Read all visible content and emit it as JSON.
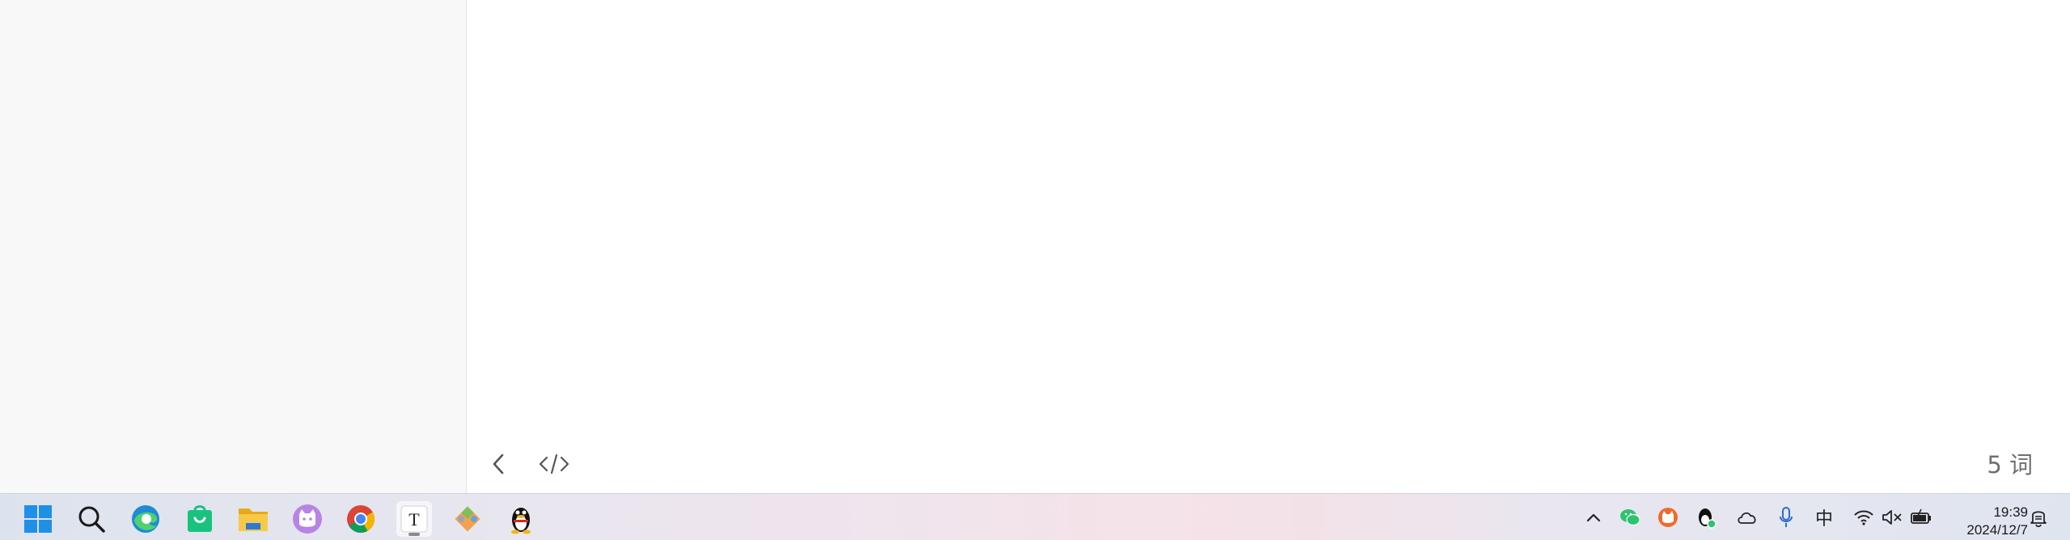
{
  "editor": {
    "word_count": "5 词",
    "footer": {
      "back_icon": "chevron-left-icon",
      "source_icon": "code-icon"
    }
  },
  "taskbar": {
    "apps": [
      {
        "name": "start-button",
        "icon": "windows-logo-icon"
      },
      {
        "name": "search-button",
        "icon": "search-icon"
      },
      {
        "name": "edge-app",
        "icon": "edge-icon"
      },
      {
        "name": "store-app",
        "icon": "shopping-bag-icon"
      },
      {
        "name": "explorer-app",
        "icon": "folder-icon"
      },
      {
        "name": "cat-app",
        "icon": "cat-icon"
      },
      {
        "name": "chrome-app",
        "icon": "chrome-icon"
      },
      {
        "name": "typora-app",
        "icon": "typora-icon",
        "label": "T",
        "active": true
      },
      {
        "name": "git-app",
        "icon": "git-icon"
      },
      {
        "name": "qq-app",
        "icon": "qq-penguin-icon"
      }
    ],
    "tray": {
      "ime_label": "中",
      "time": "19:39",
      "date": "2024/12/7"
    }
  },
  "colors": {
    "sidebar_bg": "#f8f8f8",
    "editor_bg": "#ffffff",
    "windows_blue": "#1e90e8",
    "store_green": "#19c37d",
    "folder_yellow": "#f4c23d"
  }
}
